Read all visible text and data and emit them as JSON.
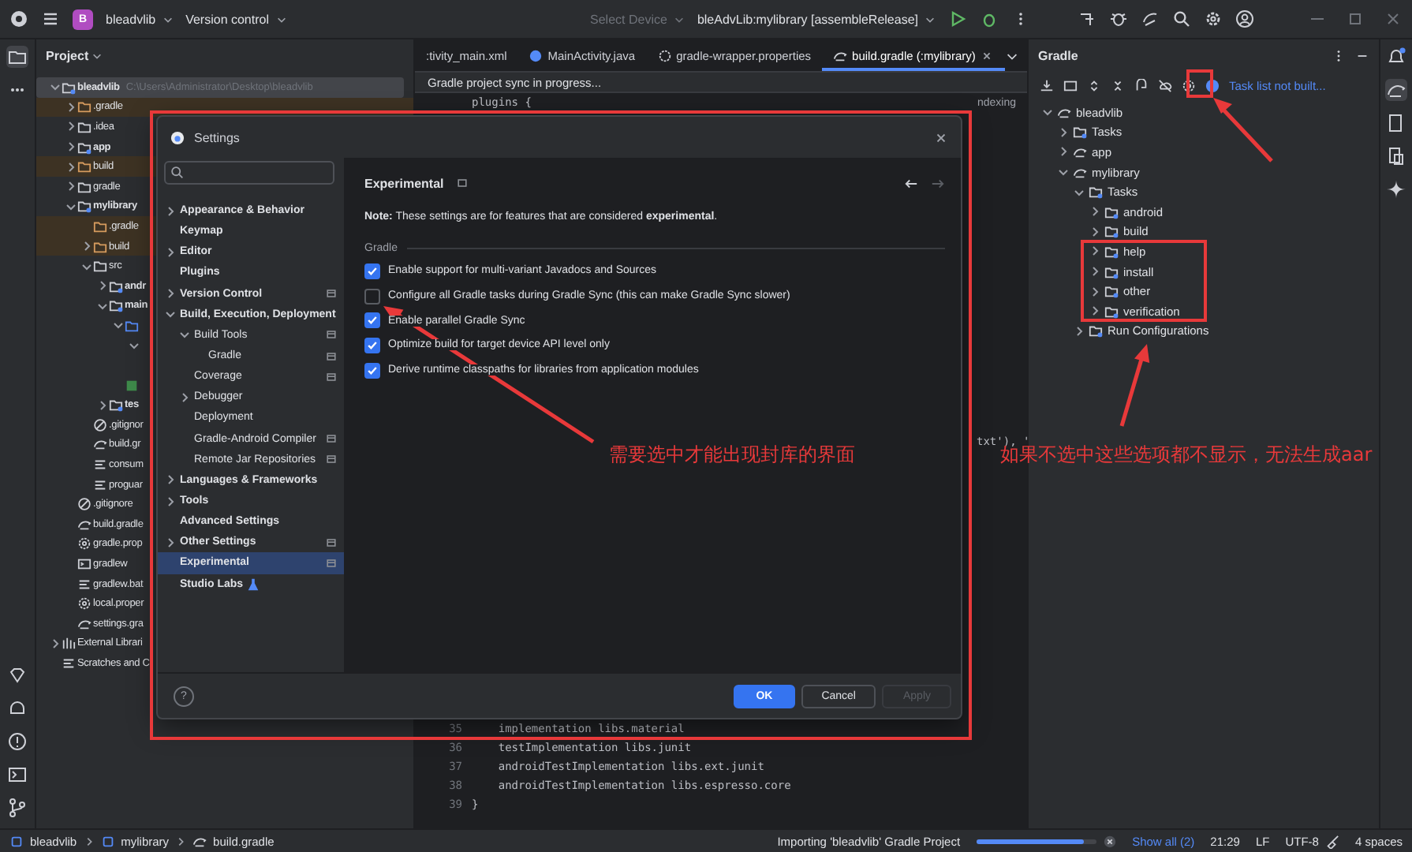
{
  "toolbar": {
    "project_initial": "B",
    "project": "bleadvlib",
    "vcs": "Version control",
    "device": "Select Device",
    "run_config": "bleAdvLib:mylibrary [assembleRelease]"
  },
  "project_panel": {
    "title": "Project",
    "tree": [
      {
        "label": "bleadvlib",
        "path": "C:\\Users\\Administrator\\Desktop\\bleadvlib",
        "kind": "module",
        "expanded": true,
        "selected": true,
        "children": [
          {
            "label": ".gradle",
            "kind": "excluded",
            "expanded": false,
            "selected": false
          },
          {
            "label": ".idea",
            "kind": "folder",
            "expanded": false,
            "selected": false
          },
          {
            "label": "app",
            "kind": "module",
            "expanded": false,
            "selected": false
          },
          {
            "label": "build",
            "kind": "excluded",
            "expanded": false,
            "selected": false
          },
          {
            "label": "gradle",
            "kind": "folder",
            "expanded": false,
            "selected": false
          },
          {
            "label": "mylibrary",
            "kind": "module",
            "expanded": true,
            "selected": false,
            "children": [
              {
                "label": ".gradle",
                "kind": "excluded",
                "selected": false
              },
              {
                "label": "build",
                "kind": "excluded",
                "expanded": false,
                "selected": false
              },
              {
                "label": "src",
                "kind": "folder",
                "expanded": true,
                "selected": false,
                "children": [
                  {
                    "label": "andr",
                    "kind": "module",
                    "expanded": false,
                    "selected": false
                  },
                  {
                    "label": "main",
                    "kind": "module",
                    "expanded": true,
                    "selected": false,
                    "children": [
                      {
                        "kind": "source",
                        "expanded": true,
                        "selected": false,
                        "children": [
                          {
                            "expanded": true,
                            "selected": false,
                            "children": [
                              {
                                "selected": false
                              }
                            ]
                          }
                        ]
                      },
                      {
                        "kind": "layout",
                        "selected": false
                      }
                    ]
                  },
                  {
                    "label": "tes",
                    "kind": "module",
                    "expanded": false,
                    "selected": false
                  }
                ]
              },
              {
                "label": ".gitignor",
                "kind": "ignore",
                "selected": false
              },
              {
                "label": "build.gr",
                "kind": "gradle",
                "selected": false
              },
              {
                "label": "consum",
                "kind": "text",
                "selected": false
              },
              {
                "label": "proguar",
                "kind": "text",
                "selected": false
              }
            ]
          },
          {
            "label": ".gitignore",
            "kind": "ignore",
            "selected": false
          },
          {
            "label": "build.gradle",
            "kind": "gradle",
            "selected": false
          },
          {
            "label": "gradle.prop",
            "kind": "properties",
            "selected": false
          },
          {
            "label": "gradlew",
            "kind": "terminal",
            "selected": false
          },
          {
            "label": "gradlew.bat",
            "kind": "text",
            "selected": false
          },
          {
            "label": "local.proper",
            "kind": "properties",
            "selected": false
          },
          {
            "label": "settings.gra",
            "kind": "gradle",
            "selected": false
          }
        ]
      },
      {
        "label": "External Librari",
        "kind": "library",
        "expanded": false,
        "selected": false
      },
      {
        "label": "Scratches and C",
        "kind": "scratch",
        "selected": false
      }
    ]
  },
  "editor": {
    "tabs": [
      {
        "label": ":tivity_main.xml",
        "kind": "xml",
        "selected": false
      },
      {
        "label": "MainActivity.java",
        "kind": "java",
        "selected": false
      },
      {
        "label": "gradle-wrapper.properties",
        "kind": "properties",
        "selected": false
      },
      {
        "label": "build.gradle (:mylibrary)",
        "kind": "gradle",
        "selected": true
      }
    ],
    "banner": "Gradle project sync in progress...",
    "top_line": "plugins {",
    "indexing": "ndexing",
    "middle_fragment": "txt'), '",
    "lines": [
      {
        "number": "35",
        "code": "    implementation libs.material"
      },
      {
        "number": "36",
        "code": "    testImplementation libs.junit"
      },
      {
        "number": "37",
        "code": "    androidTestImplementation libs.ext.junit"
      },
      {
        "number": "38",
        "code": "    androidTestImplementation libs.espresso.core"
      },
      {
        "number": "39",
        "code": "}"
      }
    ]
  },
  "gradle_panel": {
    "title": "Gradle",
    "notice": "Task list not built...",
    "tree": [
      {
        "label": "bleadvlib",
        "kind": "project",
        "expanded": true,
        "children": [
          {
            "label": "Tasks",
            "kind": "folder",
            "expanded": false
          },
          {
            "label": "app",
            "kind": "project",
            "expanded": false
          },
          {
            "label": "mylibrary",
            "kind": "project",
            "expanded": true,
            "children": [
              {
                "label": "Tasks",
                "kind": "folder",
                "expanded": true,
                "children": [
                  {
                    "label": "android",
                    "kind": "folder",
                    "expanded": false
                  },
                  {
                    "label": "build",
                    "kind": "folder",
                    "expanded": false
                  },
                  {
                    "label": "help",
                    "kind": "folder",
                    "expanded": false
                  },
                  {
                    "label": "install",
                    "kind": "folder",
                    "expanded": false
                  },
                  {
                    "label": "other",
                    "kind": "folder",
                    "expanded": false
                  },
                  {
                    "label": "verification",
                    "kind": "folder",
                    "expanded": false
                  }
                ]
              },
              {
                "label": "Run Configurations",
                "kind": "folder",
                "expanded": false
              }
            ]
          }
        ]
      }
    ]
  },
  "settings_dialog": {
    "title": "Settings",
    "nav": [
      {
        "label": "Appearance & Behavior",
        "expanded": false,
        "project_level": false,
        "selected": false
      },
      {
        "label": "Keymap",
        "project_level": false,
        "selected": false
      },
      {
        "label": "Editor",
        "expanded": false,
        "project_level": false,
        "selected": false
      },
      {
        "label": "Plugins",
        "project_level": false,
        "selected": false
      },
      {
        "label": "Version Control",
        "expanded": false,
        "project_level": true,
        "selected": false
      },
      {
        "label": "Build, Execution, Deployment",
        "expanded": true,
        "project_level": false,
        "selected": false,
        "children": [
          {
            "label": "Build Tools",
            "expanded": true,
            "project_level": true,
            "selected": false,
            "children": [
              {
                "label": "Gradle",
                "project_level": true,
                "selected": false
              }
            ]
          },
          {
            "label": "Coverage",
            "project_level": true,
            "selected": false
          },
          {
            "label": "Debugger",
            "expanded": false,
            "project_level": false,
            "selected": false
          },
          {
            "label": "Deployment",
            "project_level": false,
            "selected": false
          },
          {
            "label": "Gradle-Android Compiler",
            "project_level": true,
            "selected": false
          },
          {
            "label": "Remote Jar Repositories",
            "project_level": true,
            "selected": false
          }
        ]
      },
      {
        "label": "Languages & Frameworks",
        "expanded": false,
        "project_level": false,
        "selected": false
      },
      {
        "label": "Tools",
        "expanded": false,
        "project_level": false,
        "selected": false
      },
      {
        "label": "Advanced Settings",
        "project_level": false,
        "selected": false
      },
      {
        "label": "Other Settings",
        "expanded": false,
        "project_level": true,
        "selected": false
      },
      {
        "label": "Experimental",
        "project_level": true,
        "selected": true
      },
      {
        "label": "Studio Labs",
        "project_level": false,
        "selected": false,
        "kind": "labs"
      }
    ],
    "page_title": "Experimental",
    "note": "**Note:** These settings are for features that are considered **experimental**.",
    "section": "Gradle",
    "options": [
      {
        "label": "Enable support for multi-variant Javadocs and Sources",
        "checked": true
      },
      {
        "label": "Configure all Gradle tasks during Gradle Sync (this can make Gradle Sync slower)",
        "checked": false
      },
      {
        "label": "Enable parallel Gradle Sync",
        "checked": true
      },
      {
        "label": "Optimize build for target device API level only",
        "checked": true
      },
      {
        "label": "Derive runtime classpaths for libraries from application modules",
        "checked": true
      }
    ],
    "help": "?",
    "buttons": [
      {
        "label": "OK",
        "kind": "primary",
        "disabled": false
      },
      {
        "label": "Cancel",
        "kind": "secondary",
        "disabled": false
      },
      {
        "label": "Apply",
        "kind": "secondary",
        "disabled": true
      }
    ]
  },
  "status_bar": {
    "breadcrumbs": [
      {
        "label": "bleadvlib",
        "kind": "module"
      },
      {
        "label": "mylibrary",
        "kind": "module"
      },
      {
        "label": "build.gradle",
        "kind": "gradle"
      }
    ],
    "task": "Importing 'bleadvlib' Gradle Project",
    "progress": {
      "level": 0.9
    },
    "show_all": "Show all (2)",
    "position": "21:29",
    "line_ending": "LF",
    "encoding": "UTF-8",
    "indent": "4 spaces"
  },
  "annotations": [
    {
      "text": "需要选中才能出现封库的界面"
    },
    {
      "text": "如果不选中这些选项都不显示，无法生成aar"
    }
  ]
}
